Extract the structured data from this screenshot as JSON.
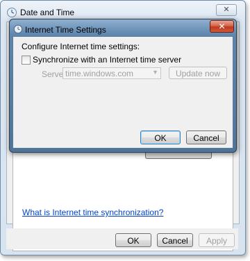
{
  "outer_window": {
    "title": "Date and Time",
    "close_glyph": "✕",
    "help_link": "What is Internet time synchronization?",
    "buttons": {
      "ok": "OK",
      "cancel": "Cancel",
      "apply": "Apply"
    }
  },
  "dialog": {
    "title": "Internet Time Settings",
    "close_glyph": "✕",
    "configure_label": "Configure Internet time settings:",
    "sync_checkbox": {
      "label": "Synchronize with an Internet time server",
      "checked": false
    },
    "server": {
      "label": "Server:",
      "value": "time.windows.com",
      "enabled": false
    },
    "update_button": "Update now",
    "ok_button": "OK",
    "cancel_button": "Cancel"
  },
  "icons": {
    "window_icon": "clock-icon",
    "dropdown_icon": "chevron-down-icon"
  },
  "colors": {
    "link": "#0044cc",
    "close_button_red": "#c0391c",
    "disabled_text": "#a0a0a0"
  }
}
